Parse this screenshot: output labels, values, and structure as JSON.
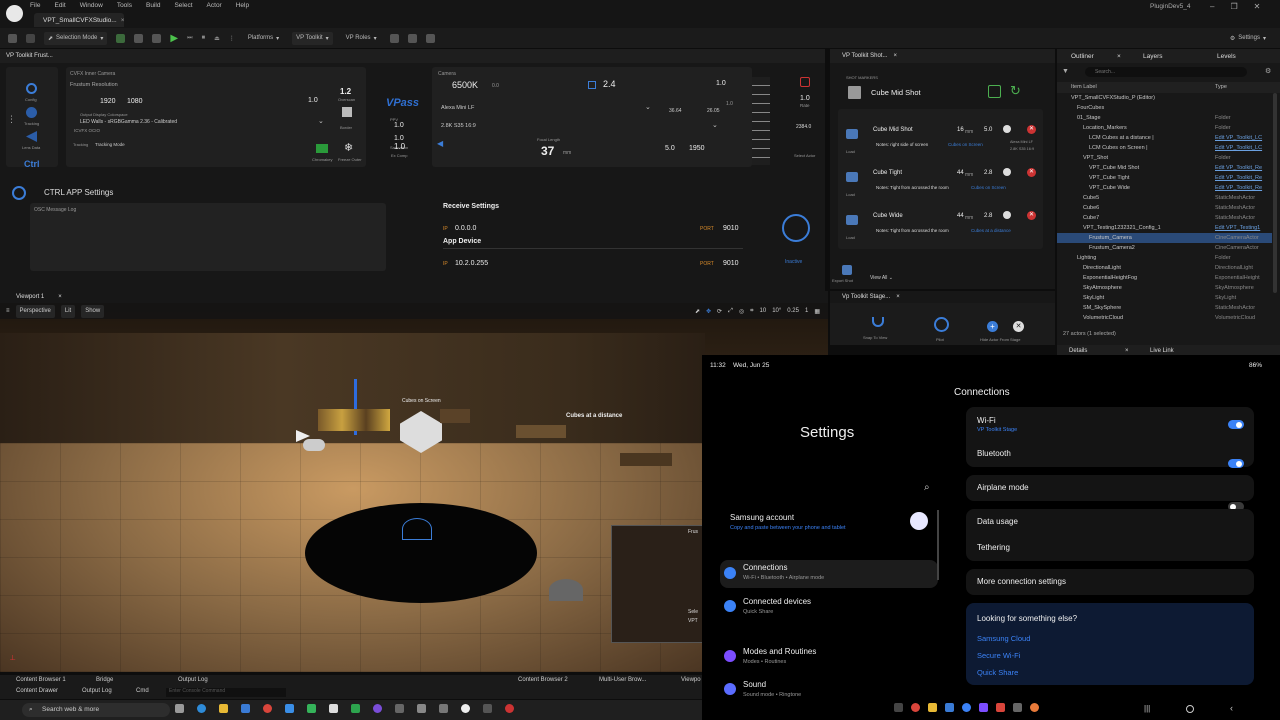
{
  "app": {
    "menus": [
      "File",
      "Edit",
      "Window",
      "Tools",
      "Build",
      "Select",
      "Actor",
      "Help"
    ],
    "document_tab": "VPT_SmallCVFXStudio...",
    "window_title": "PluginDev5_4"
  },
  "toolbar": {
    "selection_mode": "Selection Mode",
    "platforms": "Platforms",
    "vp_toolkit": "VP Toolkit",
    "vp_roles": "VP Roles",
    "settings": "Settings"
  },
  "vp_panel": {
    "tab": "VP Toolkit Frust...",
    "labels": {
      "config": "Config",
      "tracking": "Tracking",
      "lens_data": "Lens Data",
      "ctrl": "Ctrl"
    },
    "frustum": {
      "header": "CVFX Inner Camera",
      "title": "Frustum Resolution",
      "width": "1920",
      "height": "1080",
      "output_label": "Output Display Colorspace",
      "output_value": "LED Walls - sRGBGamma 2.36 - Calibrated",
      "ocio": "ICVFX OCIO",
      "tracking_label": "Tracking",
      "tracking_value": "Tracking Mode",
      "overscan": "1.2",
      "overscan_label": "Overscan",
      "adaptive": "1.0",
      "border_label": "Border",
      "chromakey_label": "Chromakey",
      "freeze_label": "Freeze Outer"
    },
    "vpass": {
      "logo": "VPass",
      "ppv": "PPV",
      "ppv_value": "1.0",
      "saturation": "1.0",
      "saturation_label": "Saturation",
      "ex_comp": "1.0",
      "ex_comp_label": "Ex Comp"
    },
    "camera": {
      "header": "Camera",
      "wb": "6500K",
      "tint": "0.0",
      "exposure": "2.4",
      "iso_value": "1.0",
      "body": "Alexa Mini LF",
      "format": "2.8K S35 16:9",
      "sensor_w": "36.64",
      "sensor_h": "26.05",
      "squeeze": "1.0",
      "focal_label": "Focal Length",
      "focal": "37",
      "focal_unit": "mm",
      "fstop": "5.0",
      "focus": "1950"
    },
    "rate": {
      "label": "Rate",
      "value": "1.0",
      "value2": "2384.0",
      "select_actor": "Select Actor"
    },
    "ctrl_title": "CTRL APP Settings",
    "osc_log": "OSC Message Log",
    "receive_title": "Receive Settings",
    "receive_ip": "0.0.0.0",
    "receive_port": "9010",
    "app_device": "App Device",
    "device_ip": "10.2.0.255",
    "device_port": "9010",
    "ip_label": "IP",
    "port_label": "PORT",
    "status": "Inactive"
  },
  "shot_panel": {
    "tab": "VP Toolkit Shot...",
    "header": "SHOT MARKERS",
    "current": "Cube Mid Shot",
    "load": "Load",
    "shots": [
      {
        "name": "Cube Mid Shot",
        "mm": "16",
        "fstop": "5.0",
        "notes": "Notes: right side of screen",
        "link": "Cubes on Screen",
        "camera": "Alexa Mini LF",
        "format": "2.8K S35 16:9"
      },
      {
        "name": "Cube Tight",
        "mm": "44",
        "fstop": "2.8",
        "notes": "Notes: Tight from acrossed the room",
        "link": "Cubes on Screen"
      },
      {
        "name": "Cube Wide",
        "mm": "44",
        "fstop": "2.8",
        "notes": "Notes: Tight from acrossed the room",
        "link": "Cubes at a distance"
      }
    ],
    "mm_unit": "mm",
    "export": "Export Shot",
    "view_all": "View All"
  },
  "stage_panel": {
    "tab": "Vp Toolkit Stage...",
    "buttons": [
      "Snap To View",
      "Pilot",
      "Hide Actor From Stage"
    ]
  },
  "outliner": {
    "tabs": [
      "Outliner",
      "Layers",
      "Levels"
    ],
    "search_placeholder": "Search...",
    "col_label": "Item Label",
    "col_type": "Type",
    "rows": [
      {
        "label": "VPT_SmallCVFXStudio_P (Editor)",
        "type": "",
        "indent": 1
      },
      {
        "label": "FourCubes",
        "type": "",
        "indent": 2
      },
      {
        "label": "01_Stage",
        "type": "Folder",
        "indent": 2
      },
      {
        "label": "Location_Markers",
        "type": "Folder",
        "indent": 3
      },
      {
        "label": "LCM Cubes at a distance |",
        "type": "Edit VP_Toolkit_LC",
        "indent": 4,
        "link": true
      },
      {
        "label": "LCM Cubes on Screen |",
        "type": "Edit VP_Toolkit_LC",
        "indent": 4,
        "link": true
      },
      {
        "label": "VPT_Shot",
        "type": "Folder",
        "indent": 3
      },
      {
        "label": "VPT_Cube Mid Shot",
        "type": "Edit VP_Toolkit_Re",
        "indent": 4,
        "link": true
      },
      {
        "label": "VPT_Cube Tight",
        "type": "Edit VP_Toolkit_Re",
        "indent": 4,
        "link": true
      },
      {
        "label": "VPT_Cube Wide",
        "type": "Edit VP_Toolkit_Re",
        "indent": 4,
        "link": true
      },
      {
        "label": "Cube5",
        "type": "StaticMeshActor",
        "indent": 3
      },
      {
        "label": "Cube6",
        "type": "StaticMeshActor",
        "indent": 3
      },
      {
        "label": "Cube7",
        "type": "StaticMeshActor",
        "indent": 3
      },
      {
        "label": "VPT_Testing1232321_Config_1",
        "type": "Edit VPT_Testing1",
        "indent": 3,
        "link": true
      },
      {
        "label": "Frustum_Camera",
        "type": "CineCameraActor",
        "indent": 4,
        "selected": true
      },
      {
        "label": "Frustum_Camera2",
        "type": "CineCameraActor",
        "indent": 4
      },
      {
        "label": "Lighting",
        "type": "Folder",
        "indent": 2
      },
      {
        "label": "DirectionalLight",
        "type": "DirectionalLight",
        "indent": 3
      },
      {
        "label": "ExponentialHeightFog",
        "type": "ExponentialHeight",
        "indent": 3
      },
      {
        "label": "SkyAtmosphere",
        "type": "SkyAtmosphere",
        "indent": 3
      },
      {
        "label": "SkyLight",
        "type": "SkyLight",
        "indent": 3
      },
      {
        "label": "SM_SkySphere",
        "type": "StaticMeshActor",
        "indent": 3
      },
      {
        "label": "VolumetricCloud",
        "type": "VolumetricCloud",
        "indent": 3
      }
    ],
    "count": "27 actors (1 selected)",
    "details": "Details",
    "live_link": "Live Link"
  },
  "viewport": {
    "tab": "Viewport 1",
    "perspective": "Perspective",
    "lit": "Lit",
    "show": "Show",
    "grid": "10",
    "angle": "10°",
    "scale": "0.25",
    "cam_speed": "1",
    "label_cubes_screen": "Cubes on Screen",
    "label_cubes_distance": "Cubes at a distance",
    "frus_label": "Frus",
    "sele_label": "Sele",
    "vpt_label": "VPT"
  },
  "bottom": {
    "tabs_row1": [
      "Content Browser 1",
      "Bridge",
      "Output Log",
      "Content Browser 2",
      "Multi-User Brow...",
      "Viewpo"
    ],
    "tabs_row2": [
      "Content Drawer",
      "Output Log",
      "Cmd"
    ],
    "console_placeholder": "Enter Console Command"
  },
  "taskbar": {
    "search": "Search web & more"
  },
  "phone": {
    "time": "11:32",
    "date": "Wed, Jun 25",
    "battery": "86%",
    "settings_title": "Settings",
    "account_title": "Samsung account",
    "account_sub": "Copy and paste between your phone and tablet",
    "items": [
      {
        "title": "Connections",
        "sub": "Wi-Fi • Bluetooth • Airplane mode",
        "active": true
      },
      {
        "title": "Connected devices",
        "sub": "Quick Share"
      },
      {
        "title": "Modes and Routines",
        "sub": "Modes • Routines"
      },
      {
        "title": "Sound",
        "sub": "Sound mode • Ringtone"
      }
    ],
    "connections_title": "Connections",
    "wifi": "Wi-Fi",
    "wifi_sub": "VP Toolkit Stage",
    "bluetooth": "Bluetooth",
    "airplane": "Airplane mode",
    "data_usage": "Data usage",
    "tethering": "Tethering",
    "more": "More connection settings",
    "looking": "Looking for something else?",
    "links": [
      "Samsung Cloud",
      "Secure Wi-Fi",
      "Quick Share"
    ]
  }
}
